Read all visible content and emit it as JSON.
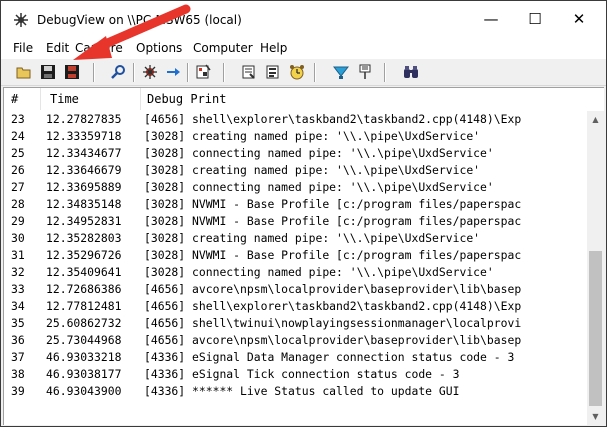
{
  "window": {
    "title": "DebugView on \\\\PC-MSW65 (local)",
    "minimize_glyph": "—",
    "maximize_glyph": "☐",
    "close_glyph": "✕"
  },
  "menu": [
    "File",
    "Edit",
    "Capture",
    "Options",
    "Computer",
    "Help"
  ],
  "toolbar": {
    "icons": [
      "open-icon",
      "save-icon",
      "save-all-icon",
      "find-icon",
      "capture-icon",
      "autoscroll-icon",
      "clear-icon",
      "filter-icon",
      "highlight-icon",
      "clock-icon",
      "history-icon",
      "pin-icon",
      "binoculars-icon"
    ]
  },
  "columns": {
    "num": "#",
    "time": "Time",
    "debug": "Debug Print"
  },
  "rows": [
    {
      "num": "23",
      "time": "12.27827835",
      "pid": "[4656]",
      "msg": "shell\\explorer\\taskband2\\taskband2.cpp(4148)\\Exp"
    },
    {
      "num": "24",
      "time": "12.33359718",
      "pid": "[3028]",
      "msg": "creating named pipe: '\\\\.\\pipe\\UxdService'"
    },
    {
      "num": "25",
      "time": "12.33434677",
      "pid": "[3028]",
      "msg": "connecting named pipe: '\\\\.\\pipe\\UxdService'"
    },
    {
      "num": "26",
      "time": "12.33646679",
      "pid": "[3028]",
      "msg": "creating named pipe: '\\\\.\\pipe\\UxdService'"
    },
    {
      "num": "27",
      "time": "12.33695889",
      "pid": "[3028]",
      "msg": "connecting named pipe: '\\\\.\\pipe\\UxdService'"
    },
    {
      "num": "28",
      "time": "12.34835148",
      "pid": "[3028]",
      "msg": "NVWMI - Base Profile [c:/program files/paperspac"
    },
    {
      "num": "29",
      "time": "12.34952831",
      "pid": "[3028]",
      "msg": "NVWMI - Base Profile [c:/program files/paperspac"
    },
    {
      "num": "30",
      "time": "12.35282803",
      "pid": "[3028]",
      "msg": "creating named pipe: '\\\\.\\pipe\\UxdService'"
    },
    {
      "num": "31",
      "time": "12.35296726",
      "pid": "[3028]",
      "msg": "NVWMI - Base Profile [c:/program files/paperspac"
    },
    {
      "num": "32",
      "time": "12.35409641",
      "pid": "[3028]",
      "msg": "connecting named pipe: '\\\\.\\pipe\\UxdService'"
    },
    {
      "num": "33",
      "time": "12.72686386",
      "pid": "[4656]",
      "msg": "avcore\\npsm\\localprovider\\baseprovider\\lib\\basep"
    },
    {
      "num": "34",
      "time": "12.77812481",
      "pid": "[4656]",
      "msg": "shell\\explorer\\taskband2\\taskband2.cpp(4148)\\Exp"
    },
    {
      "num": "35",
      "time": "25.60862732",
      "pid": "[4656]",
      "msg": "shell\\twinui\\nowplayingsessionmanager\\localprovi"
    },
    {
      "num": "36",
      "time": "25.73044968",
      "pid": "[4656]",
      "msg": "avcore\\npsm\\localprovider\\baseprovider\\lib\\basep"
    },
    {
      "num": "37",
      "time": "46.93033218",
      "pid": "[4336]",
      "msg": "eSignal Data Manager connection status code - 3"
    },
    {
      "num": "38",
      "time": "46.93038177",
      "pid": "[4336]",
      "msg": "eSignal Tick connection status code - 3"
    },
    {
      "num": "39",
      "time": "46.93043900",
      "pid": "[4336]",
      "msg": "****** Live Status called to update GUI"
    }
  ],
  "scrollbar": {
    "up_glyph": "▲",
    "down_glyph": "▼"
  },
  "colors": {
    "annotation_arrow": "#e8352c",
    "title_bg": "#ffffff",
    "toolbar_bg": "#f0f0f0"
  }
}
